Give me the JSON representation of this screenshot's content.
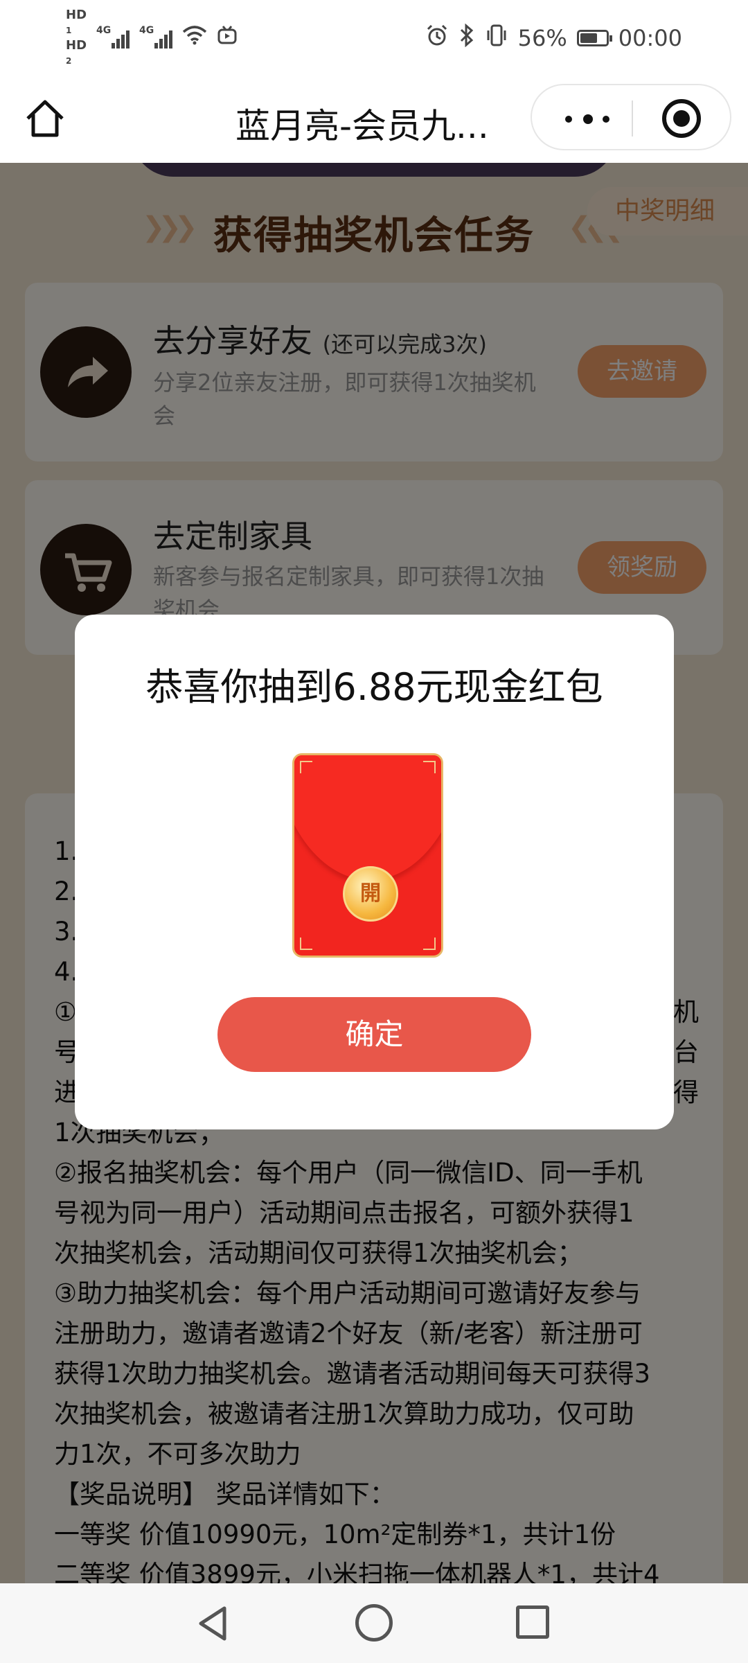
{
  "status_bar": {
    "hd1": "HD",
    "hd1_sub": "1",
    "hd2": "HD",
    "hd2_sub": "2",
    "net1": "4G",
    "net2": "4G",
    "battery_percent": "56%",
    "time": "00:00"
  },
  "nav": {
    "title": "蓝月亮-会员九..."
  },
  "page": {
    "task_section_title": "获得抽奖机会任务",
    "detail_tab": "中奖明细",
    "tasks": [
      {
        "name": "去分享好友",
        "note": "(还可以完成3次)",
        "desc": "分享2位亲友注册，即可获得1次抽奖机会",
        "button": "去邀请"
      },
      {
        "name": "去定制家具",
        "note": "",
        "desc": "新客参与报名定制家具，即可获得1次抽奖机会",
        "button": "领奖励"
      }
    ],
    "rules_lines": [
      "1.",
      "2.",
      "3.",
      "4.",
      "①",
      "号",
      "进",
      "1次抽奖机会；",
      "②报名抽奖机会：每个用户（同一微信ID、同一手机",
      "号视为同一用户）活动期间点击报名，可额外获得1",
      "次抽奖机会，活动期间仅可获得1次抽奖机会；",
      "③助力抽奖机会：每个用户活动期间可邀请好友参与",
      "注册助力，邀请者邀请2个好友（新/老客）新注册可",
      "获得1次助力抽奖机会。邀请者活动期间每天可获得3",
      "次抽奖机会，被邀请者注册1次算助力成功，仅可助",
      "力1次，不可多次助力",
      "【奖品说明】 奖品详情如下：",
      "一等奖 价值10990元，10m²定制券*1，共计1份",
      "二等奖 价值3899元，小米扫拖一体机器人*1，共计4"
    ],
    "rules_right_fragments": [
      "机",
      "台",
      "得"
    ]
  },
  "modal": {
    "title": "恭喜你抽到6.88元现金红包",
    "envelope_seal": "開",
    "confirm": "确定",
    "colors": {
      "envelope": "#f2251f",
      "confirm": "#e8574a"
    }
  },
  "colors": {
    "task_button": "#f6a36a",
    "task_title": "#5a2e12"
  }
}
